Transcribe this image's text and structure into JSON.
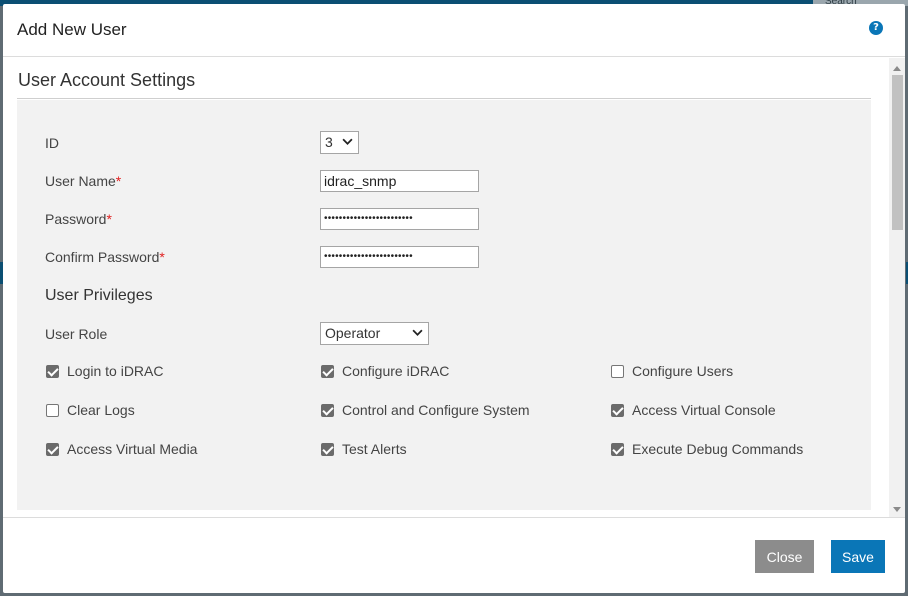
{
  "background": {
    "search_text": "Search"
  },
  "modal": {
    "title": "Add New User",
    "help_icon": "question-circle-icon",
    "help_symbol": "?"
  },
  "section": {
    "title": "User Account Settings"
  },
  "form": {
    "id": {
      "label": "ID",
      "value": "3"
    },
    "username": {
      "label": "User Name",
      "value": "idrac_snmp",
      "required_mark": "*"
    },
    "password": {
      "label": "Password",
      "value": "••••••••••••••••••••••••",
      "required_mark": "*"
    },
    "confirm_password": {
      "label": "Confirm Password",
      "value": "••••••••••••••••••••••••",
      "required_mark": "*"
    }
  },
  "privileges": {
    "heading": "User Privileges",
    "role": {
      "label": "User Role",
      "value": "Operator"
    },
    "items": [
      {
        "label": "Login to iDRAC",
        "checked": true
      },
      {
        "label": "Configure iDRAC",
        "checked": true
      },
      {
        "label": "Configure Users",
        "checked": false
      },
      {
        "label": "Clear Logs",
        "checked": false
      },
      {
        "label": "Control and Configure System",
        "checked": true
      },
      {
        "label": "Access Virtual Console",
        "checked": true
      },
      {
        "label": "Access Virtual Media",
        "checked": true
      },
      {
        "label": "Test Alerts",
        "checked": true
      },
      {
        "label": "Execute Debug Commands",
        "checked": true
      }
    ]
  },
  "footer": {
    "close_label": "Close",
    "save_label": "Save"
  },
  "colors": {
    "primary": "#0a76b7",
    "secondary_button": "#8c8c8c",
    "required": "#e02020",
    "panel": "#f2f2f2"
  }
}
